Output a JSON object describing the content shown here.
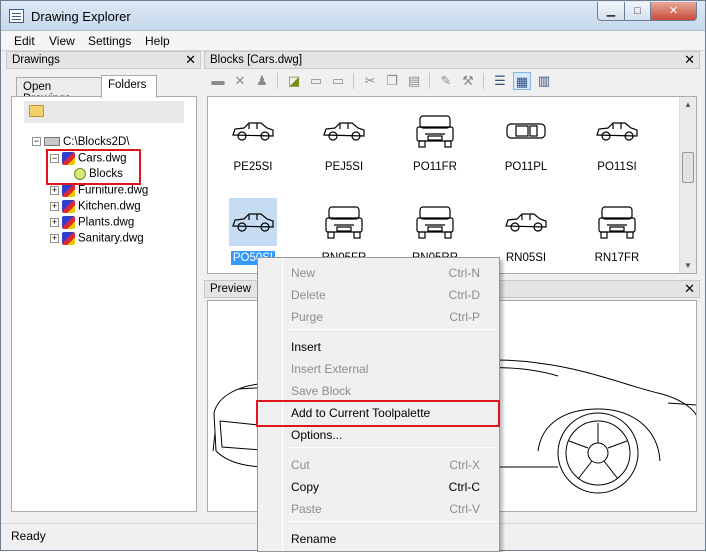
{
  "window": {
    "title": "Drawing Explorer"
  },
  "menu": [
    "Edit",
    "View",
    "Settings",
    "Help"
  ],
  "drawings_panel": {
    "header": "Drawings",
    "tabs": [
      {
        "label": "Open Drawings",
        "active": false
      },
      {
        "label": "Folders",
        "active": true
      }
    ],
    "tree": {
      "root": "C:\\Blocks2D\\",
      "items": [
        {
          "label": "Cars.dwg",
          "expanded": true,
          "child": "Blocks"
        },
        {
          "label": "Furniture.dwg"
        },
        {
          "label": "Kitchen.dwg"
        },
        {
          "label": "Plants.dwg"
        },
        {
          "label": "Sanitary.dwg"
        }
      ]
    }
  },
  "blocks_panel": {
    "header": "Blocks [Cars.dwg]",
    "toolbar_icons": [
      "delete-icon",
      "cut-icon",
      "copy-icon",
      "paste-icon",
      "properties-icon",
      "settings-icon",
      "view-details-icon",
      "view-large-icons-icon",
      "view-list-icon"
    ],
    "blocks": [
      {
        "name": "PE25SI",
        "view": "side"
      },
      {
        "name": "PEJ5SI",
        "view": "side"
      },
      {
        "name": "PO11FR",
        "view": "front"
      },
      {
        "name": "PO11PL",
        "view": "plan"
      },
      {
        "name": "PO11SI",
        "view": "side"
      },
      {
        "name": "PO50SI",
        "view": "side",
        "selected": true
      },
      {
        "name": "RN05FR",
        "view": "front"
      },
      {
        "name": "RN05RR",
        "view": "rear"
      },
      {
        "name": "RN05SI",
        "view": "side"
      },
      {
        "name": "RN17FR",
        "view": "front"
      }
    ]
  },
  "preview_panel": {
    "header": "Preview"
  },
  "context_menu": {
    "items": [
      {
        "label": "New",
        "shortcut": "Ctrl-N",
        "enabled": false
      },
      {
        "label": "Delete",
        "shortcut": "Ctrl-D",
        "enabled": false
      },
      {
        "label": "Purge",
        "shortcut": "Ctrl-P",
        "enabled": false
      },
      {
        "label": "Insert",
        "shortcut": "",
        "enabled": true
      },
      {
        "label": "Insert External",
        "shortcut": "",
        "enabled": false
      },
      {
        "label": "Save Block",
        "shortcut": "",
        "enabled": false
      },
      {
        "label": "Add to Current Toolpalette",
        "shortcut": "",
        "enabled": true,
        "highlighted": true
      },
      {
        "label": "Options...",
        "shortcut": "",
        "enabled": true
      },
      {
        "label": "Cut",
        "shortcut": "Ctrl-X",
        "enabled": false
      },
      {
        "label": "Copy",
        "shortcut": "Ctrl-C",
        "enabled": true
      },
      {
        "label": "Paste",
        "shortcut": "Ctrl-V",
        "enabled": false
      },
      {
        "label": "Rename",
        "shortcut": "",
        "enabled": true
      }
    ]
  },
  "status": {
    "text": "Ready"
  },
  "colors": {
    "highlight_red": "#e0141e",
    "selection_blue": "#3399ff"
  }
}
